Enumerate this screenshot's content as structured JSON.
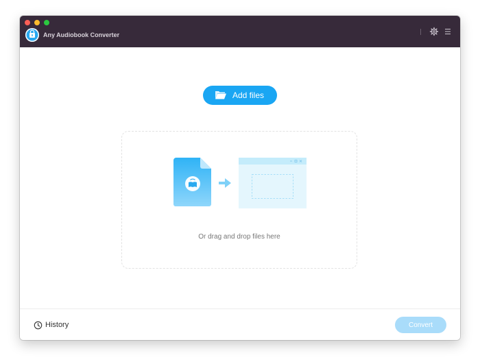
{
  "window": {
    "app_title": "Any Audiobook Converter"
  },
  "toolbar": {
    "icons": [
      "gear-icon",
      "menu-icon"
    ]
  },
  "main": {
    "add_files_label": "Add files",
    "drop_hint": "Or drag and drop files here"
  },
  "footer": {
    "history_label": "History",
    "convert_label": "Convert",
    "convert_enabled": false
  },
  "colors": {
    "titlebar": "#372a3a",
    "accent": "#1aa6f3",
    "convert_disabled": "#a9dcfa",
    "illustration_light": "#e4f6fd",
    "illustration_border": "#c4ecfb"
  }
}
